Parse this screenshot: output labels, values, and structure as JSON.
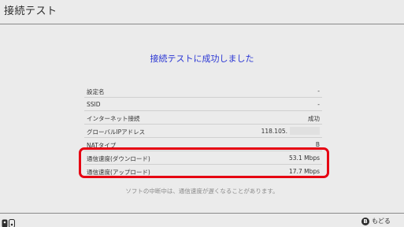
{
  "header": {
    "title": "接続テスト"
  },
  "main": {
    "success_message": "接続テストに成功しました",
    "rows": [
      {
        "label": "設定名",
        "value": "-"
      },
      {
        "label": "SSID",
        "value": "-"
      },
      {
        "label": "インターネット接続",
        "value": "成功"
      },
      {
        "label": "グローバルIPアドレス",
        "value": "118.105."
      },
      {
        "label": "NATタイプ",
        "value": "B"
      },
      {
        "label": "通信速度(ダウンロード)",
        "value": "53.1 Mbps"
      },
      {
        "label": "通信速度(アップロード)",
        "value": "17.7 Mbps"
      }
    ],
    "note": "ソフトの中断中は、通信速度が遅くなることがあります。"
  },
  "footer": {
    "controller_icon": "joycon-icon",
    "back_button_glyph": "B",
    "back_label": "もどる"
  },
  "colors": {
    "accent": "#2a36d4",
    "highlight": "#e60012",
    "background": "#ebebeb"
  }
}
